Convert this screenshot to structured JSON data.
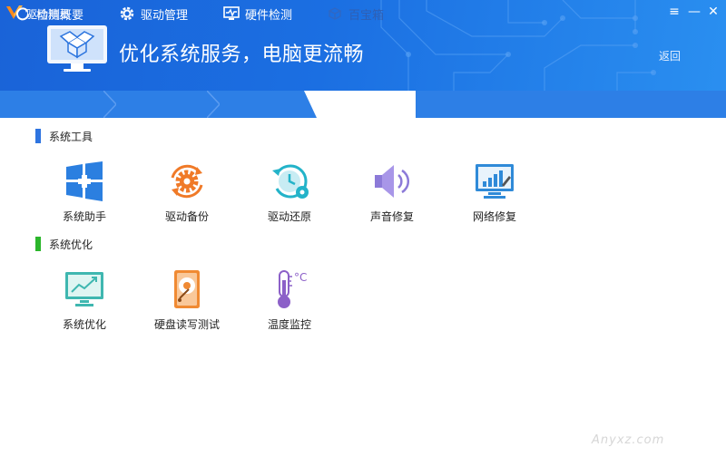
{
  "app": {
    "name": "驱动精灵"
  },
  "window": {
    "menu_glyph": "≡",
    "minimize_glyph": "—",
    "close_glyph": "✕"
  },
  "banner": {
    "title": "优化系统服务，电脑更流畅",
    "back_label": "返回"
  },
  "tabs": [
    {
      "label": "检测概要",
      "icon": "refresh-check-icon",
      "active": false
    },
    {
      "label": "驱动管理",
      "icon": "gear-icon",
      "active": false
    },
    {
      "label": "硬件检测",
      "icon": "monitor-pulse-icon",
      "active": false
    },
    {
      "label": "百宝箱",
      "icon": "toolbox-icon",
      "active": true
    }
  ],
  "sections": [
    {
      "title": "系统工具",
      "accent": "#2e74e0",
      "items": [
        {
          "label": "系统助手",
          "icon": "windows-plus-icon"
        },
        {
          "label": "驱动备份",
          "icon": "gear-cycle-icon"
        },
        {
          "label": "驱动还原",
          "icon": "clock-restore-icon"
        },
        {
          "label": "声音修复",
          "icon": "speaker-icon"
        },
        {
          "label": "网络修复",
          "icon": "network-monitor-icon"
        }
      ]
    },
    {
      "title": "系统优化",
      "accent": "#2bb62b",
      "items": [
        {
          "label": "系统优化",
          "icon": "trend-monitor-icon"
        },
        {
          "label": "硬盘读写测试",
          "icon": "hard-disk-icon"
        },
        {
          "label": "温度监控",
          "icon": "thermometer-icon"
        }
      ]
    }
  ],
  "watermark": "Anyxz.com"
}
